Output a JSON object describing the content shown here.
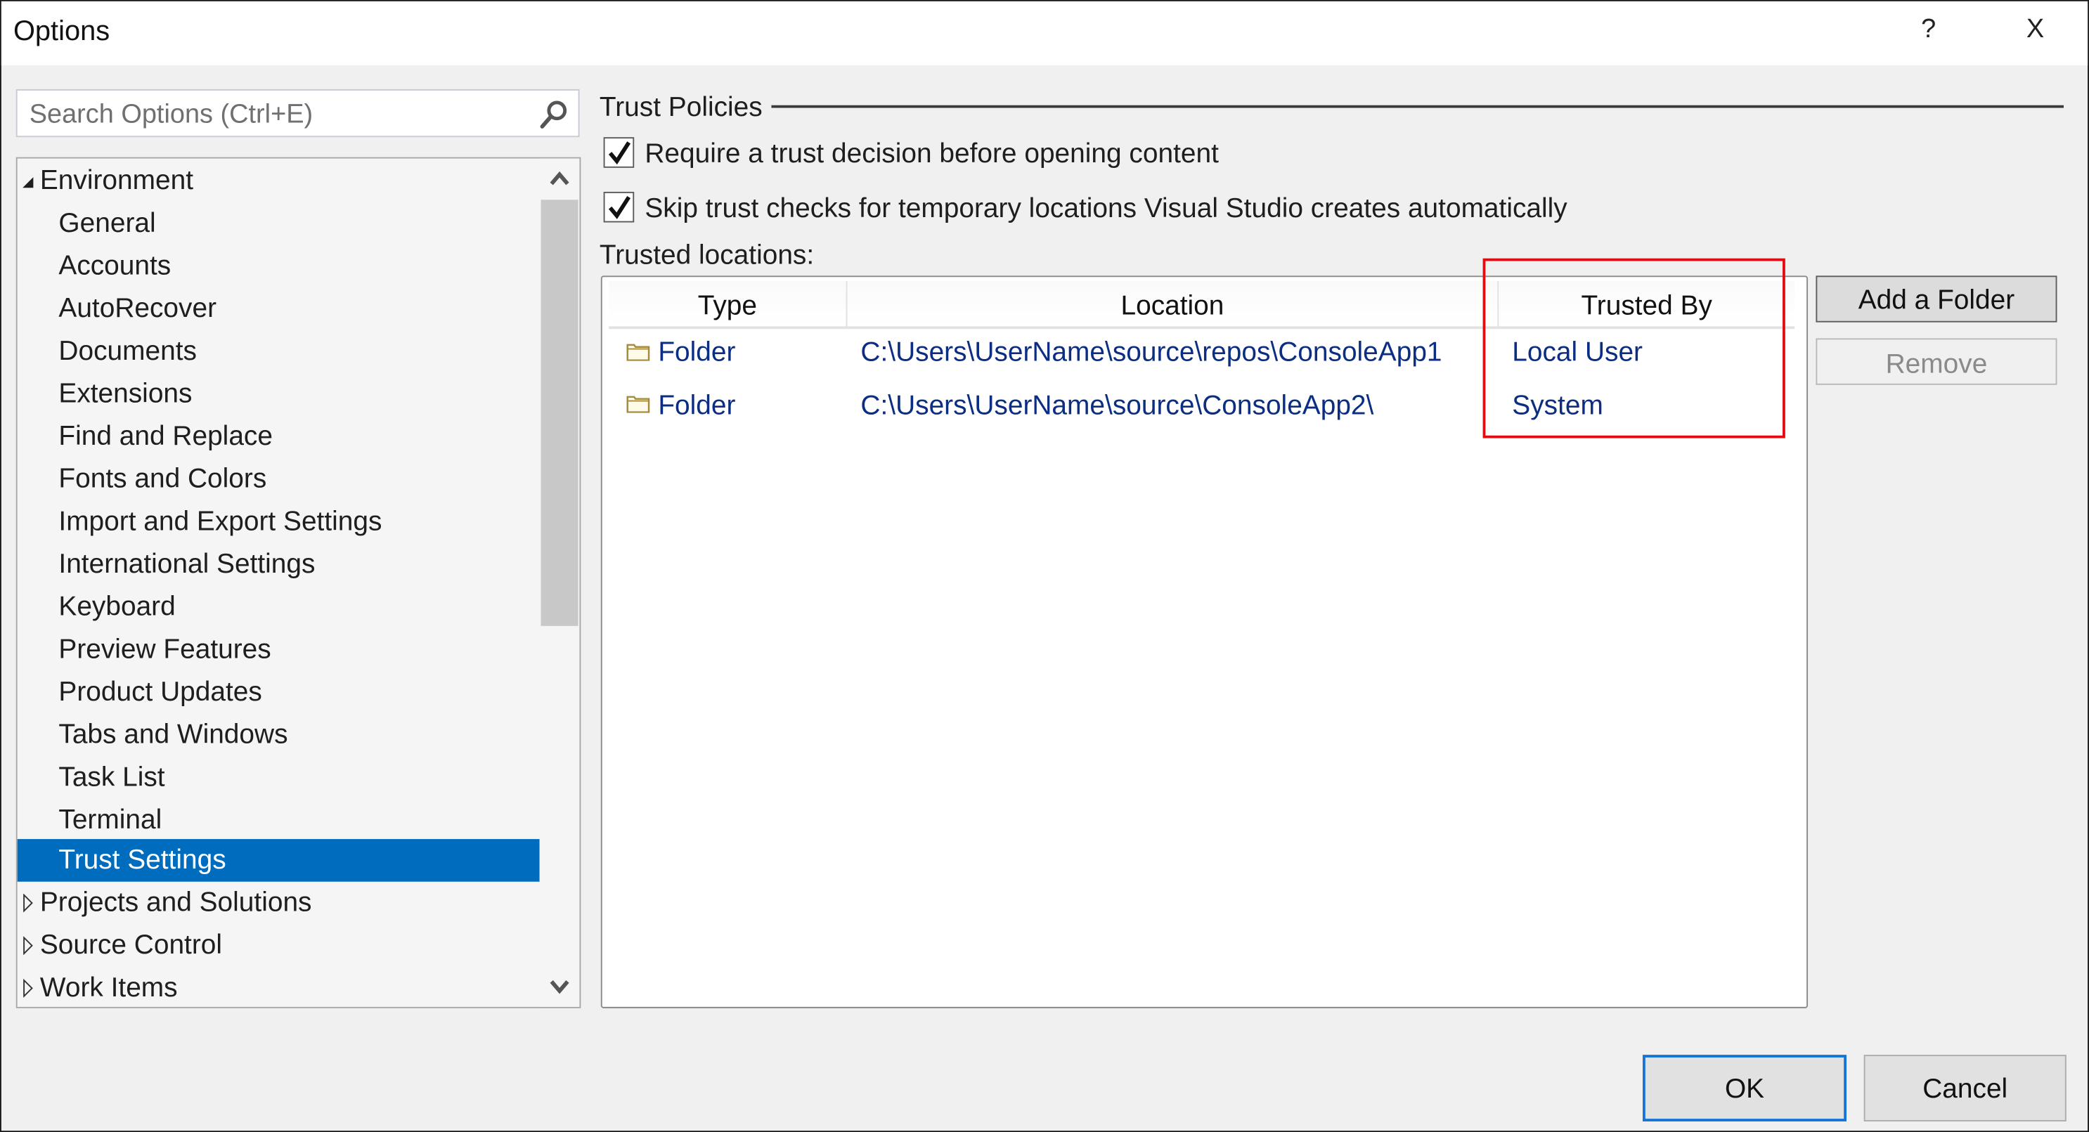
{
  "window": {
    "title": "Options",
    "help_label": "?",
    "close_label": "X"
  },
  "search": {
    "placeholder": "Search Options (Ctrl+E)",
    "value": "",
    "icon": "search-icon"
  },
  "tree": {
    "items": [
      {
        "label": "Environment",
        "level": 0,
        "expander": "expanded"
      },
      {
        "label": "General",
        "level": 1
      },
      {
        "label": "Accounts",
        "level": 1
      },
      {
        "label": "AutoRecover",
        "level": 1
      },
      {
        "label": "Documents",
        "level": 1
      },
      {
        "label": "Extensions",
        "level": 1
      },
      {
        "label": "Find and Replace",
        "level": 1
      },
      {
        "label": "Fonts and Colors",
        "level": 1
      },
      {
        "label": "Import and Export Settings",
        "level": 1
      },
      {
        "label": "International Settings",
        "level": 1
      },
      {
        "label": "Keyboard",
        "level": 1
      },
      {
        "label": "Preview Features",
        "level": 1
      },
      {
        "label": "Product Updates",
        "level": 1
      },
      {
        "label": "Tabs and Windows",
        "level": 1
      },
      {
        "label": "Task List",
        "level": 1
      },
      {
        "label": "Terminal",
        "level": 1
      },
      {
        "label": "Trust Settings",
        "level": 1,
        "selected": true
      },
      {
        "label": "Projects and Solutions",
        "level": 0,
        "expander": "collapsed"
      },
      {
        "label": "Source Control",
        "level": 0,
        "expander": "collapsed"
      },
      {
        "label": "Work Items",
        "level": 0,
        "expander": "collapsed"
      }
    ],
    "selected_color": "#006cbe"
  },
  "trust_policies": {
    "group_label": "Trust Policies",
    "checkboxes": [
      {
        "label": "Require a trust decision before opening content",
        "checked": true
      },
      {
        "label": "Skip trust checks for temporary locations Visual Studio creates automatically",
        "checked": true
      }
    ]
  },
  "trusted_locations": {
    "label": "Trusted locations:",
    "columns": [
      "Type",
      "Location",
      "Trusted By"
    ],
    "rows": [
      {
        "type": "Folder",
        "location": "C:\\Users\\UserName\\source\\repos\\ConsoleApp1",
        "trusted_by": "Local User"
      },
      {
        "type": "Folder",
        "location": "C:\\Users\\UserName\\source\\ConsoleApp2\\",
        "trusted_by": "System"
      }
    ],
    "highlight_color": "#e00b13",
    "link_color": "#0b2e83"
  },
  "buttons": {
    "add_folder": "Add a Folder",
    "remove": "Remove",
    "ok": "OK",
    "cancel": "Cancel"
  }
}
